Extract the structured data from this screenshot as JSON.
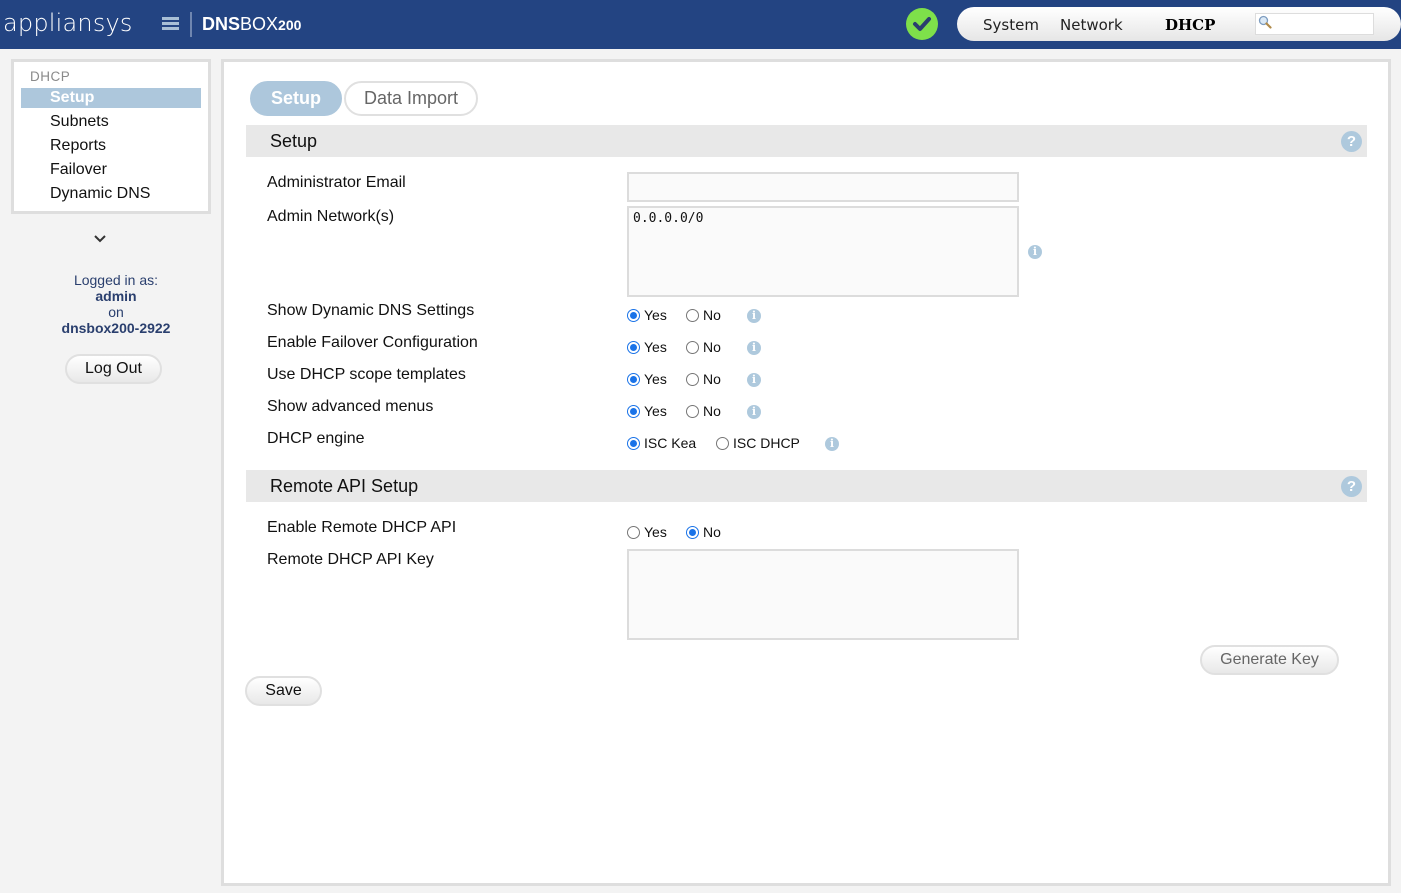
{
  "header": {
    "brand": "appliansys",
    "product_bold": "DNS",
    "product_regular": "BOX",
    "product_model": "200",
    "status_icon": "check-circle-icon",
    "nav": [
      {
        "label": "System",
        "active": false
      },
      {
        "label": "Network",
        "active": false
      },
      {
        "label": "DHCP",
        "active": true
      }
    ],
    "search": {
      "placeholder": "",
      "value": "",
      "icon": "magnifier-icon"
    }
  },
  "sidebar": {
    "section_title": "DHCP",
    "items": [
      {
        "label": "Setup",
        "active": true
      },
      {
        "label": "Subnets",
        "active": false
      },
      {
        "label": "Reports",
        "active": false
      },
      {
        "label": "Failover",
        "active": false
      },
      {
        "label": "Dynamic DNS",
        "active": false
      }
    ],
    "expand_icon": "chevron-down-icon",
    "login": {
      "prefix": "Logged in as:",
      "user": "admin",
      "on": "on",
      "host": "dnsbox200-2922"
    },
    "logout_label": "Log Out"
  },
  "main": {
    "tabs": [
      {
        "label": "Setup",
        "active": true
      },
      {
        "label": "Data Import",
        "active": false
      }
    ],
    "setup_section": {
      "title": "Setup",
      "fields": {
        "admin_email": {
          "label": "Administrator Email",
          "value": ""
        },
        "admin_networks": {
          "label": "Admin Network(s)",
          "value": "0.0.0.0/0"
        },
        "show_ddns": {
          "label": "Show Dynamic DNS Settings",
          "options": [
            "Yes",
            "No"
          ],
          "selected": "Yes"
        },
        "enable_failover": {
          "label": "Enable Failover Configuration",
          "options": [
            "Yes",
            "No"
          ],
          "selected": "Yes"
        },
        "scope_templates": {
          "label": "Use DHCP scope templates",
          "options": [
            "Yes",
            "No"
          ],
          "selected": "Yes"
        },
        "advanced_menus": {
          "label": "Show advanced menus",
          "options": [
            "Yes",
            "No"
          ],
          "selected": "Yes"
        },
        "dhcp_engine": {
          "label": "DHCP engine",
          "options": [
            "ISC Kea",
            "ISC DHCP"
          ],
          "selected": "ISC Kea"
        }
      }
    },
    "remote_api_section": {
      "title": "Remote API Setup",
      "fields": {
        "enable_remote_api": {
          "label": "Enable Remote DHCP API",
          "options": [
            "Yes",
            "No"
          ],
          "selected": "No"
        },
        "api_key": {
          "label": "Remote DHCP API Key",
          "value": ""
        }
      },
      "generate_key_label": "Generate Key"
    },
    "save_label": "Save"
  },
  "colors": {
    "header_bg": "#234482",
    "accent": "#adc7dc",
    "status_ok": "#7ee04a",
    "radio_checked": "#1a73e8"
  }
}
